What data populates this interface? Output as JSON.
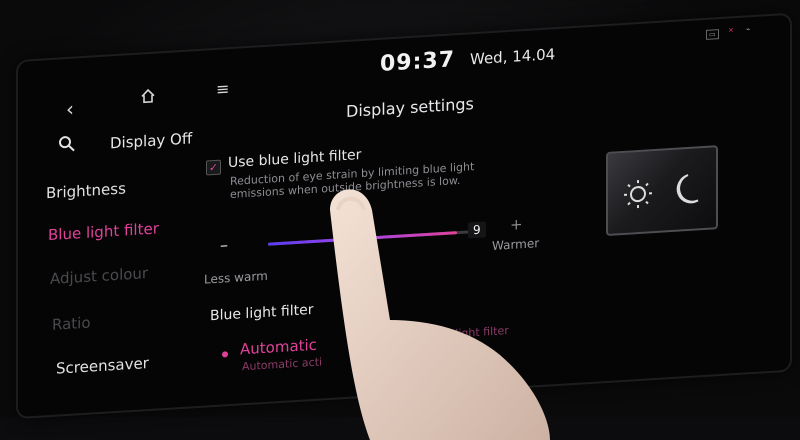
{
  "status": {
    "time": "09:37",
    "date": "Wed, 14.04",
    "indicators": [
      "cam-icon",
      "signal-icon",
      "usb-icon"
    ]
  },
  "nav": {
    "back_icon": "back-chevron-icon",
    "home_icon": "home-icon",
    "menu_icon": "menu-icon",
    "search_icon": "search-icon"
  },
  "header": {
    "display_off": "Display Off",
    "title": "Display settings"
  },
  "sidebar": {
    "items": [
      {
        "label": "Brightness",
        "state": "normal"
      },
      {
        "label": "Blue light filter",
        "state": "active"
      },
      {
        "label": "Adjust colour",
        "state": "disabled"
      },
      {
        "label": "Ratio",
        "state": "disabled"
      },
      {
        "label": "Screensaver",
        "state": "normal"
      }
    ]
  },
  "blue_light": {
    "checkbox_label": "Use blue light filter",
    "checked": true,
    "description_line1": "Reduction of eye strain by limiting blue light",
    "description_line2": "emissions when outside brightness is low.",
    "slider": {
      "value": "9",
      "level_fraction": 0.9,
      "minus_label": "–",
      "plus_label": "+",
      "less_label": "Less warm",
      "more_label": "Warmer"
    },
    "section_label": "Blue light filter",
    "option_label": "Automatic",
    "option_desc_left": "Automatic acti",
    "option_desc_right": "blue light filter"
  },
  "colors": {
    "accent": "#e0429a",
    "slider_start": "#5b3cf2",
    "background": "#050506"
  }
}
